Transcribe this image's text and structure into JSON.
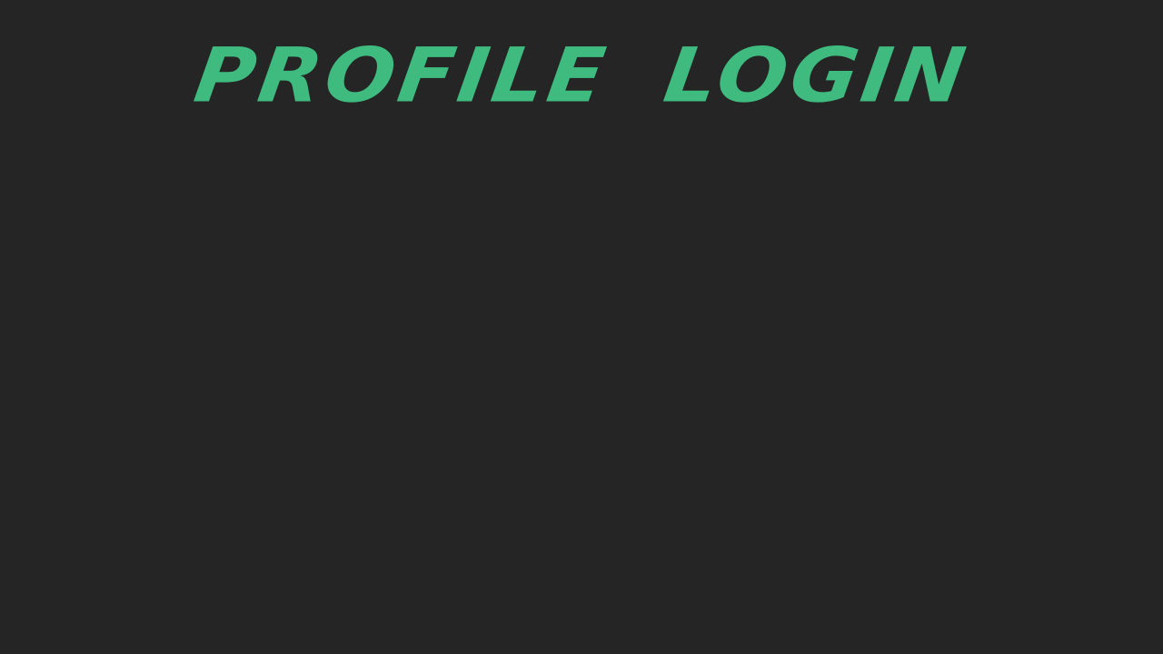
{
  "screen": {
    "title": "PROFILE LOGIN",
    "background_color": "#252525",
    "accent_color": "#3fbb80"
  }
}
